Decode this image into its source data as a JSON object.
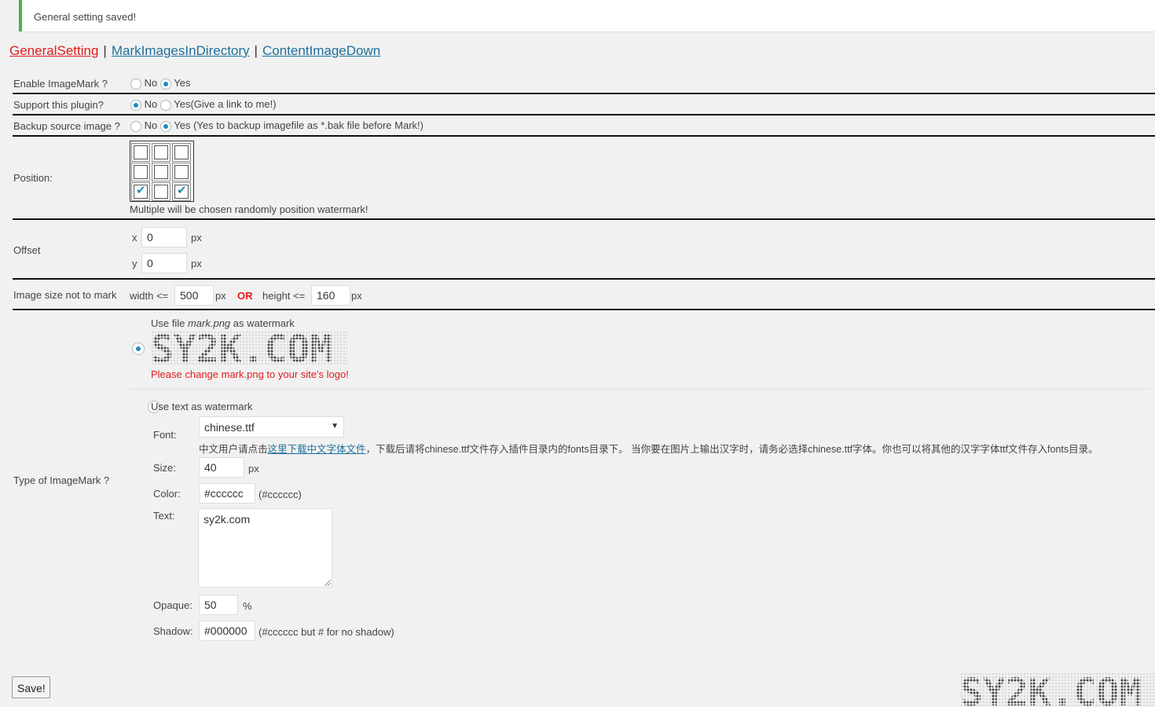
{
  "notice": {
    "message": "General setting saved!"
  },
  "nav": {
    "tabs": [
      {
        "label": "GeneralSetting",
        "active": true
      },
      {
        "label": "MarkImagesInDirectory",
        "active": false
      },
      {
        "label": "ContentImageDown",
        "active": false
      }
    ],
    "separator": "|"
  },
  "enable": {
    "label": "Enable ImageMark ?",
    "no": "No",
    "yes": "Yes",
    "selected": "Yes"
  },
  "support": {
    "label": "Support this plugin?",
    "no": "No",
    "yes": "Yes(Give a link to me!)",
    "selected": "No"
  },
  "backup": {
    "label": "Backup source image ?",
    "no": "No",
    "yes": "Yes (Yes to backup imagefile as *.bak file before Mark!)",
    "selected": "Yes"
  },
  "position": {
    "label": "Position:",
    "cells": [
      false,
      false,
      false,
      false,
      false,
      false,
      true,
      false,
      true
    ],
    "note": "Multiple will be chosen randomly position watermark!"
  },
  "offset": {
    "label": "Offset",
    "x_label": "x",
    "x_value": "0",
    "y_label": "y",
    "y_value": "0",
    "unit": "px"
  },
  "size_limit": {
    "label": "Image size not to mark",
    "width_label": "width <=",
    "width_value": "500",
    "or": "OR",
    "height_label": "height <=",
    "height_value": "160",
    "unit": "px"
  },
  "type": {
    "label": "Type of ImageMark ?",
    "file_option": {
      "prefix": "Use file ",
      "filename": "mark.png",
      "suffix": " as watermark",
      "selected": true,
      "warning": "Please change mark.png to your site's logo!"
    },
    "text_option": {
      "label": "Use text as watermark",
      "selected": false,
      "font_label": "Font:",
      "font_value": "chinese.ttf",
      "font_note_before": "中文用户请点击",
      "font_note_link": "这里下载中文字体文件",
      "font_note_after": "，下载后请将chinese.ttf文件存入插件目录内的fonts目录下。 当你要在图片上输出汉字时，请务必选择chinese.ttf字体。你也可以将其他的汉字字体ttf文件存入fonts目录。",
      "size_label": "Size:",
      "size_value": "40",
      "size_unit": "px",
      "color_label": "Color:",
      "color_value": "#cccccc",
      "color_hint": "(#cccccc)",
      "text_label": "Text:",
      "text_value": "sy2k.com",
      "opaque_label": "Opaque:",
      "opaque_value": "50",
      "opaque_unit": "%",
      "shadow_label": "Shadow:",
      "shadow_value": "#000000",
      "shadow_hint": "(#cccccc but # for no shadow)"
    }
  },
  "save_button": "Save!",
  "watermark_logo_text": "SY2K.COM",
  "colors": {
    "accent": "#1e8cbe",
    "active_tab": "#e01b1b",
    "link": "#1f6f9c",
    "notice_border": "#46b450"
  }
}
